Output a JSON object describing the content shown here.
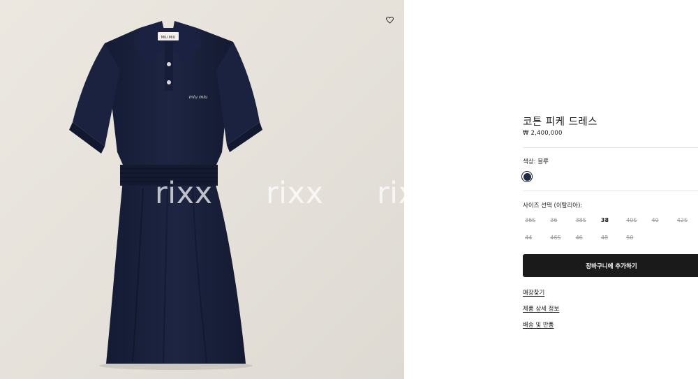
{
  "gallery": {
    "watermark": [
      "rixx",
      "rixx",
      "rixx"
    ],
    "label_logo": "MIU MIU",
    "chest_logo": "miu miu",
    "wishlist_icon": "heart-outline-icon"
  },
  "product": {
    "title": "코튼 피케 드레스",
    "price": "₩ 2,400,000",
    "color_label": "색상:  블루",
    "selected_color": "#1f2a44",
    "size_label": "사이즈 선택 (이탈리아):",
    "sizes": [
      {
        "label": "36S",
        "available": false
      },
      {
        "label": "36",
        "available": false
      },
      {
        "label": "38S",
        "available": false
      },
      {
        "label": "38",
        "available": true
      },
      {
        "label": "40S",
        "available": false
      },
      {
        "label": "40",
        "available": false
      },
      {
        "label": "42S",
        "available": false
      },
      {
        "label": "44",
        "available": false
      },
      {
        "label": "46S",
        "available": false
      },
      {
        "label": "46",
        "available": false
      },
      {
        "label": "48",
        "available": false
      },
      {
        "label": "50",
        "available": false
      }
    ],
    "add_to_cart_label": "장바구니에 추가하기",
    "links": {
      "store_finder": "매장찾기",
      "details": "제품 상세 정보",
      "shipping": "배송 및 반품"
    }
  }
}
